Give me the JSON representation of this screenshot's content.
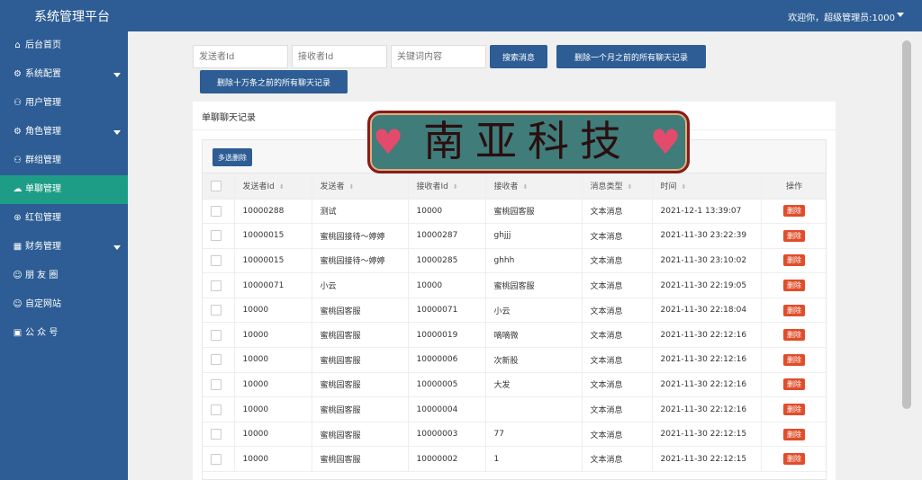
{
  "app": {
    "title": "系统管理平台",
    "user_greeting": "欢迎你，超级管理员:1000"
  },
  "sidebar": {
    "items": [
      {
        "label": "后台首页",
        "icon": "home-icon",
        "active": false,
        "has_submenu": false
      },
      {
        "label": "系统配置",
        "icon": "gear-icon",
        "active": false,
        "has_submenu": true
      },
      {
        "label": "用户管理",
        "icon": "user-icon",
        "active": false,
        "has_submenu": false
      },
      {
        "label": "角色管理",
        "icon": "gear-icon",
        "active": false,
        "has_submenu": true
      },
      {
        "label": "群组管理",
        "icon": "user-icon",
        "active": false,
        "has_submenu": false
      },
      {
        "label": "单聊管理",
        "icon": "chat-icon",
        "active": true,
        "has_submenu": false
      },
      {
        "label": "红包管理",
        "icon": "red-packet-icon",
        "active": false,
        "has_submenu": false
      },
      {
        "label": "财务管理",
        "icon": "finance-icon",
        "active": false,
        "has_submenu": true
      },
      {
        "label": "朋 友 圈",
        "icon": "smile-icon",
        "active": false,
        "has_submenu": false
      },
      {
        "label": "自定网站",
        "icon": "smile-icon",
        "active": false,
        "has_submenu": false
      },
      {
        "label": "公 众 号",
        "icon": "image-icon",
        "active": false,
        "has_submenu": false
      }
    ]
  },
  "search": {
    "sender_placeholder": "发送者Id",
    "receiver_placeholder": "接收者Id",
    "keyword_placeholder": "关键词内容",
    "search_button": "搜索消息",
    "delete_month_button": "删除一个月之前的所有聊天记录",
    "delete_100k_button": "删除十万条之前的所有聊天记录"
  },
  "panel": {
    "title": "单聊聊天记录",
    "bulk_delete_button": "多选删除"
  },
  "table": {
    "headers": [
      "发送者Id",
      "发送者",
      "接收者Id",
      "接收者",
      "消息类型",
      "时间",
      "操作"
    ],
    "delete_label": "删除",
    "rows": [
      {
        "sender_id": "10000288",
        "sender": "测试",
        "receiver_id": "10000",
        "receiver": "蜜桃园客服",
        "type": "文本消息",
        "time": "2021-12-1 13:39:07"
      },
      {
        "sender_id": "10000015",
        "sender": "蜜桃园接待～婷婷",
        "receiver_id": "10000287",
        "receiver": "ghjjj",
        "type": "文本消息",
        "time": "2021-11-30 23:22:39"
      },
      {
        "sender_id": "10000015",
        "sender": "蜜桃园接待～婷婷",
        "receiver_id": "10000285",
        "receiver": "ghhh",
        "type": "文本消息",
        "time": "2021-11-30 23:10:02"
      },
      {
        "sender_id": "10000071",
        "sender": "小云",
        "receiver_id": "10000",
        "receiver": "蜜桃园客服",
        "type": "文本消息",
        "time": "2021-11-30 22:19:05"
      },
      {
        "sender_id": "10000",
        "sender": "蜜桃园客服",
        "receiver_id": "10000071",
        "receiver": "小云",
        "type": "文本消息",
        "time": "2021-11-30 22:18:04"
      },
      {
        "sender_id": "10000",
        "sender": "蜜桃园客服",
        "receiver_id": "10000019",
        "receiver": "嘀嘀微",
        "type": "文本消息",
        "time": "2021-11-30 22:12:16"
      },
      {
        "sender_id": "10000",
        "sender": "蜜桃园客服",
        "receiver_id": "10000006",
        "receiver": "次新股",
        "type": "文本消息",
        "time": "2021-11-30 22:12:16"
      },
      {
        "sender_id": "10000",
        "sender": "蜜桃园客服",
        "receiver_id": "10000005",
        "receiver": "大发",
        "type": "文本消息",
        "time": "2021-11-30 22:12:16"
      },
      {
        "sender_id": "10000",
        "sender": "蜜桃园客服",
        "receiver_id": "10000004",
        "receiver": "",
        "type": "文本消息",
        "time": "2021-11-30 22:12:16"
      },
      {
        "sender_id": "10000",
        "sender": "蜜桃园客服",
        "receiver_id": "10000003",
        "receiver": "77",
        "type": "文本消息",
        "time": "2021-11-30 22:12:15"
      },
      {
        "sender_id": "10000",
        "sender": "蜜桃园客服",
        "receiver_id": "10000002",
        "receiver": "1",
        "type": "文本消息",
        "time": "2021-11-30 22:12:15"
      }
    ]
  },
  "watermark": {
    "text": "南亚科技"
  }
}
